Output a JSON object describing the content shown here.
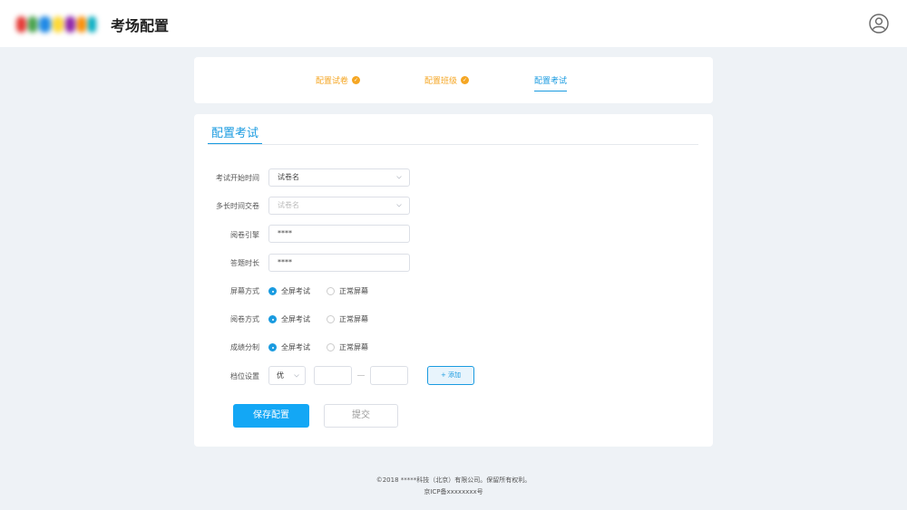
{
  "header": {
    "title": "考场配置",
    "logo_colors": [
      "#e53935",
      "#43a047",
      "#1e88e5",
      "#fdd835",
      "#8e24aa",
      "#fb8c00",
      "#00acc1"
    ]
  },
  "steps": [
    {
      "label": "配置试卷",
      "state": "done"
    },
    {
      "label": "配置班级",
      "state": "done"
    },
    {
      "label": "配置考试",
      "state": "active"
    }
  ],
  "card": {
    "title": "配置考试"
  },
  "form": {
    "start_time": {
      "label": "考试开始时间",
      "value": "试卷名"
    },
    "duration": {
      "label": "多长时间交卷",
      "placeholder": "试卷名"
    },
    "engine": {
      "label": "阅卷引擎",
      "value": "****"
    },
    "answer_time": {
      "label": "答题时长",
      "value": "****"
    },
    "screen_mode": {
      "label": "屏幕方式",
      "options": [
        "全屏考试",
        "正常屏幕"
      ],
      "selected": "全屏考试"
    },
    "review_mode": {
      "label": "阅卷方式",
      "options": [
        "全屏考试",
        "正常屏幕"
      ],
      "selected": "全屏考试"
    },
    "score_split": {
      "label": "成绩分制",
      "options": [
        "全屏考试",
        "正常屏幕"
      ],
      "selected": "全屏考试"
    },
    "grade_setting": {
      "label": "档位设置",
      "grade": "优",
      "add_label": "+ 添加"
    }
  },
  "actions": {
    "save_label": "保存配置",
    "submit_label": "提交"
  },
  "footer": {
    "copyright": "©2018 *****科技（北京）有限公司。保留所有权利。",
    "icp": "京ICP备xxxxxxxx号"
  },
  "colors": {
    "accent": "#1a9be0",
    "done": "#f5a623",
    "primary_button": "#13a7f5"
  }
}
